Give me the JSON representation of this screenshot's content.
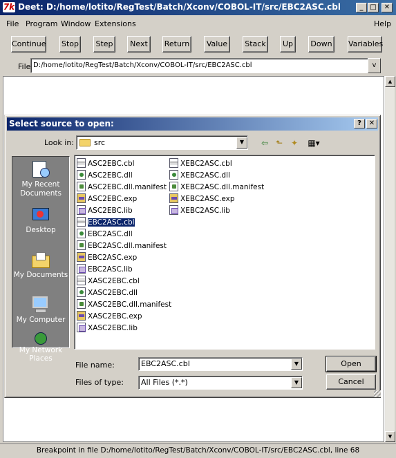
{
  "window": {
    "title": "Deet: D:/home/lotito/RegTest/Batch/Xconv/COBOL-IT/src/EBC2ASC.cbl",
    "app_icon": "7k"
  },
  "menu": [
    "File",
    "Program",
    "Window",
    "Extensions",
    "Help"
  ],
  "toolbar": {
    "buttons": [
      "Continue",
      "Stop",
      "Step",
      "Next",
      "Return",
      "Value",
      "Stack",
      "Up",
      "Down",
      "Variables"
    ]
  },
  "file_field": {
    "label": "File:",
    "value": "D:/home/lotito/RegTest/Batch/Xconv/COBOL-IT/src/EBC2ASC.cbl"
  },
  "dialog": {
    "title": "Select source to open:",
    "look_in_label": "Look in:",
    "look_in_value": "src",
    "places": [
      "My Recent Documents",
      "Desktop",
      "My Documents",
      "My Computer",
      "My Network Places"
    ],
    "files_col1": [
      {
        "name": "ASC2EBC.cbl",
        "type": "cbl"
      },
      {
        "name": "ASC2EBC.dll",
        "type": "dll"
      },
      {
        "name": "ASC2EBC.dll.manifest",
        "type": "man"
      },
      {
        "name": "ASC2EBC.exp",
        "type": "exp"
      },
      {
        "name": "ASC2EBC.lib",
        "type": "lib"
      },
      {
        "name": "EBC2ASC.cbl",
        "type": "cbl",
        "selected": true
      },
      {
        "name": "EBC2ASC.dll",
        "type": "dll"
      },
      {
        "name": "EBC2ASC.dll.manifest",
        "type": "man"
      },
      {
        "name": "EBC2ASC.exp",
        "type": "exp"
      },
      {
        "name": "EBC2ASC.lib",
        "type": "lib"
      },
      {
        "name": "XASC2EBC.cbl",
        "type": "cbl"
      },
      {
        "name": "XASC2EBC.dll",
        "type": "dll"
      },
      {
        "name": "XASC2EBC.dll.manifest",
        "type": "man"
      },
      {
        "name": "XASC2EBC.exp",
        "type": "exp"
      },
      {
        "name": "XASC2EBC.lib",
        "type": "lib"
      }
    ],
    "files_col2": [
      {
        "name": "XEBC2ASC.cbl",
        "type": "cbl"
      },
      {
        "name": "XEBC2ASC.dll",
        "type": "dll"
      },
      {
        "name": "XEBC2ASC.dll.manifest",
        "type": "man"
      },
      {
        "name": "XEBC2ASC.exp",
        "type": "exp"
      },
      {
        "name": "XEBC2ASC.lib",
        "type": "lib"
      }
    ],
    "file_name_label": "File name:",
    "file_name_value": "EBC2ASC.cbl",
    "files_of_type_label": "Files of type:",
    "files_of_type_value": "All Files (*.*)",
    "open_label": "Open",
    "cancel_label": "Cancel"
  },
  "status": "Breakpoint in file D:/home/lotito/RegTest/Batch/Xconv/COBOL-IT/src/EBC2ASC.cbl, line 68",
  "colors": {
    "title_bar": "#0a246a",
    "face": "#d4d0c8",
    "selection": "#0a246a"
  }
}
